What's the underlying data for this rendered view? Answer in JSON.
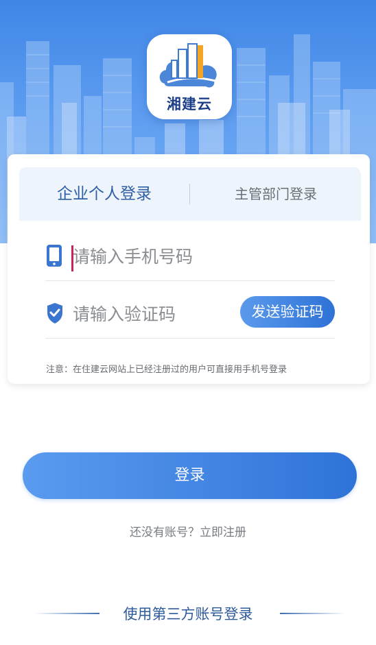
{
  "logo": {
    "text": "湘建云"
  },
  "tabs": {
    "enterprise": "企业个人登录",
    "department": "主管部门登录"
  },
  "form": {
    "phone_placeholder": "请输入手机号码",
    "code_placeholder": "请输入验证码",
    "send_code": "发送验证码",
    "note": "注意：在住建云网站上已经注册过的用户可直接用手机号登录"
  },
  "login_label": "登录",
  "register_link": "还没有账号？立即注册",
  "third_party_label": "使用第三方账号登录",
  "icons": {
    "logo": "cloud-buildings-logo",
    "phone": "mobile-phone-icon",
    "code": "shield-check-icon"
  },
  "colors": {
    "brand_blue": "#2f73d8",
    "hero_blue": "#4a8eea",
    "tab_active": "#2e5fa6",
    "caret": "#c4255a"
  }
}
